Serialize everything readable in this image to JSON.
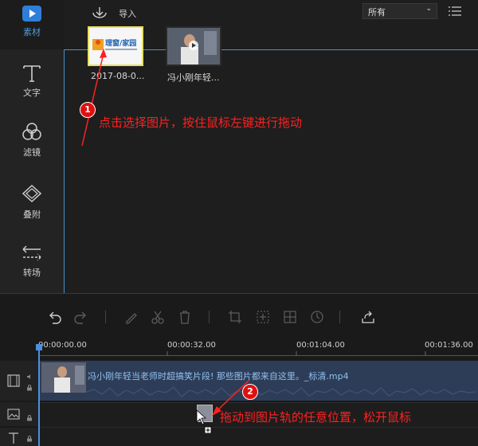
{
  "sidebar": {
    "items": [
      {
        "label": "素材",
        "icon": "media-icon"
      },
      {
        "label": "文字",
        "icon": "text-icon"
      },
      {
        "label": "滤镜",
        "icon": "filter-icon"
      },
      {
        "label": "叠附",
        "icon": "overlay-icon"
      },
      {
        "label": "转场",
        "icon": "transition-icon"
      }
    ]
  },
  "toolbar": {
    "import_label": "导入",
    "filter_value": "所有"
  },
  "media": {
    "items": [
      {
        "label": "2017-08-0...",
        "selected": true,
        "logo_text": "理窗/家园"
      },
      {
        "label": "冯小刚年轻...",
        "selected": false
      }
    ]
  },
  "timeline": {
    "ruler_labels": [
      "00:00:00.00",
      "00:00:32.00",
      "00:01:04.00",
      "00:01:36.00"
    ],
    "video_clip_title": "冯小刚年轻当老师时超搞笑片段! 那些图片都来自这里。_标清.mp4"
  },
  "annotations": {
    "step1_number": "1",
    "step1_text": "点击选择图片，按住鼠标左键进行拖动",
    "step2_number": "2",
    "step2_text": "拖动到图片轨的任意位置，松开鼠标"
  },
  "colors": {
    "accent": "#4a90c8",
    "annotation": "#ff2020",
    "clip_bg": "#2e3d57",
    "selection": "#e8e060"
  }
}
